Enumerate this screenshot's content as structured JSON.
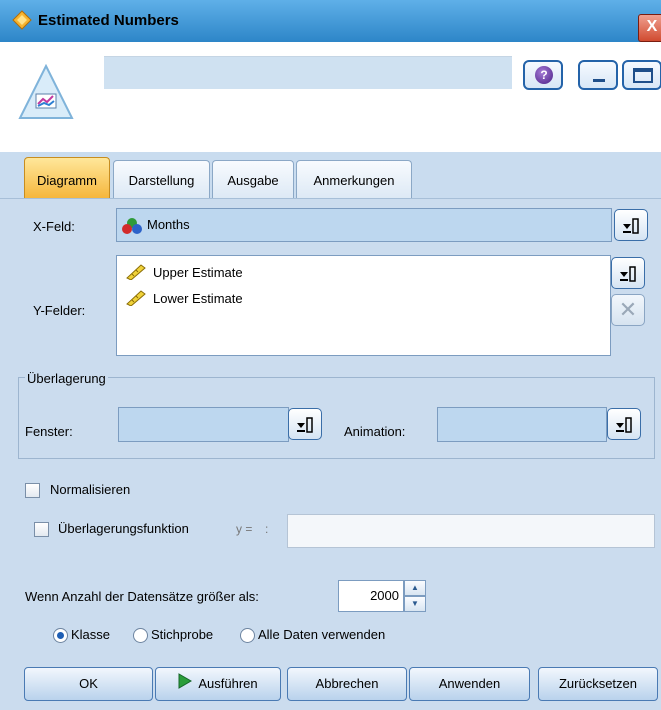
{
  "window": {
    "title": "Estimated Numbers",
    "close_label": "X"
  },
  "header": {
    "help_label": "?"
  },
  "tabs": [
    {
      "label": "Diagramm",
      "active": true
    },
    {
      "label": "Darstellung",
      "active": false
    },
    {
      "label": "Ausgabe",
      "active": false
    },
    {
      "label": "Anmerkungen",
      "active": false
    }
  ],
  "plot": {
    "x_field_label": "X-Feld:",
    "x_field_value": "Months",
    "y_fields_label": "Y-Felder:",
    "y_fields": [
      "Upper Estimate",
      "Lower Estimate"
    ],
    "remove_label": "✕"
  },
  "overlay": {
    "group_label": "Überlagerung",
    "window_label": "Fenster:",
    "animation_label": "Animation:"
  },
  "options": {
    "normalize_label": "Normalisieren",
    "overlay_function_label": "Überlagerungsfunktion",
    "y_equals_label": "y =",
    "records_label": "Wenn Anzahl der Datensätze größer als:",
    "records_value": "2000",
    "radio_options": [
      "Klasse",
      "Stichprobe",
      "Alle Daten verwenden"
    ],
    "radio_selected": "Klasse"
  },
  "buttons": {
    "ok": "OK",
    "run": "Ausführen",
    "cancel": "Abbrechen",
    "apply": "Anwenden",
    "reset": "Zurücksetzen"
  },
  "colors": {
    "title_bar": "#2d86c8",
    "panel": "#cbdcee",
    "active_tab": "#f5b53a"
  }
}
